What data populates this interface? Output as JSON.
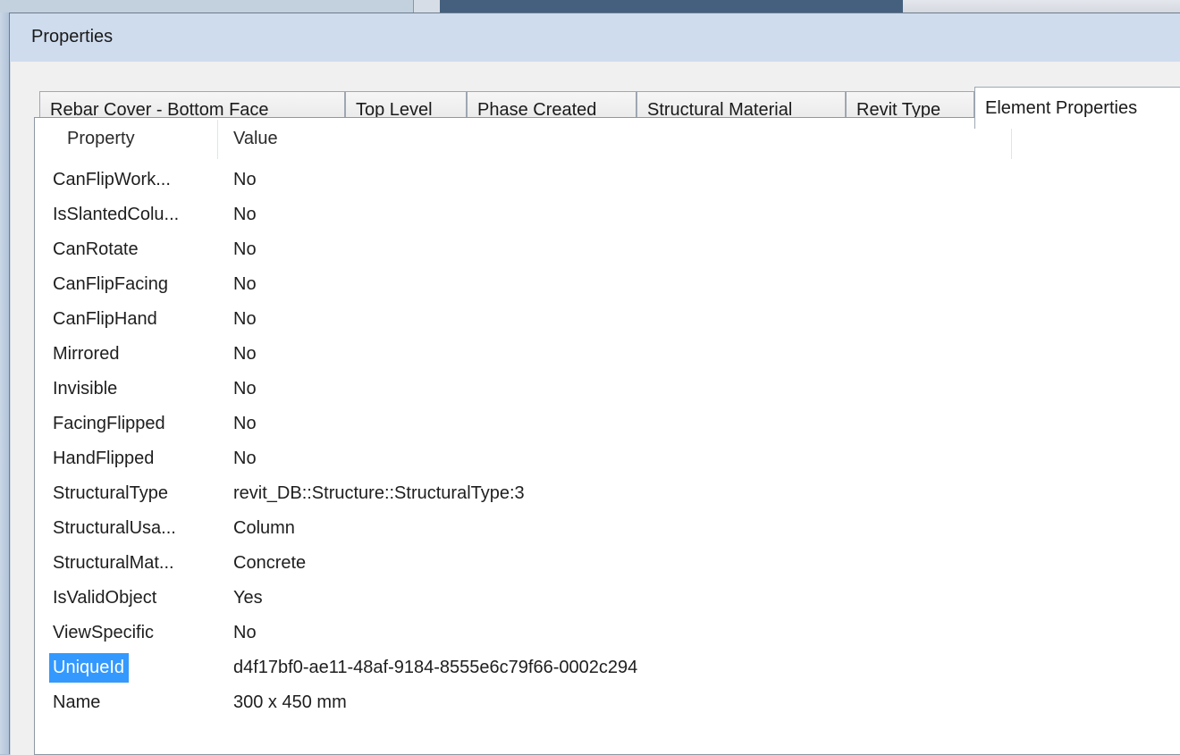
{
  "window": {
    "title": "Properties"
  },
  "tabs": [
    {
      "label": "Rebar Cover - Bottom Face",
      "active": false
    },
    {
      "label": "Top Level",
      "active": false
    },
    {
      "label": "Phase Created",
      "active": false
    },
    {
      "label": "Structural Material",
      "active": false
    },
    {
      "label": "Revit Type",
      "active": false
    },
    {
      "label": "Element Properties",
      "active": true
    }
  ],
  "table": {
    "columns": [
      "Property",
      "Value"
    ],
    "rows": [
      {
        "property": "CanFlipWork...",
        "value": "No"
      },
      {
        "property": "IsSlantedColu...",
        "value": "No"
      },
      {
        "property": "CanRotate",
        "value": "No"
      },
      {
        "property": "CanFlipFacing",
        "value": "No"
      },
      {
        "property": "CanFlipHand",
        "value": "No"
      },
      {
        "property": "Mirrored",
        "value": "No"
      },
      {
        "property": "Invisible",
        "value": "No"
      },
      {
        "property": "FacingFlipped",
        "value": "No"
      },
      {
        "property": "HandFlipped",
        "value": "No"
      },
      {
        "property": "StructuralType",
        "value": "revit_DB::Structure::StructuralType:3"
      },
      {
        "property": "StructuralUsa...",
        "value": "Column"
      },
      {
        "property": "StructuralMat...",
        "value": "Concrete"
      },
      {
        "property": "IsValidObject",
        "value": "Yes"
      },
      {
        "property": "ViewSpecific",
        "value": "No"
      },
      {
        "property": "UniqueId",
        "value": "d4f17bf0-ae11-48af-9184-8555e6c79f66-0002c294",
        "selected": true
      },
      {
        "property": "Name",
        "value": "300 x 450 mm"
      }
    ]
  },
  "colors": {
    "selection": "#3399ff",
    "titlebar": "#cfdcee"
  }
}
